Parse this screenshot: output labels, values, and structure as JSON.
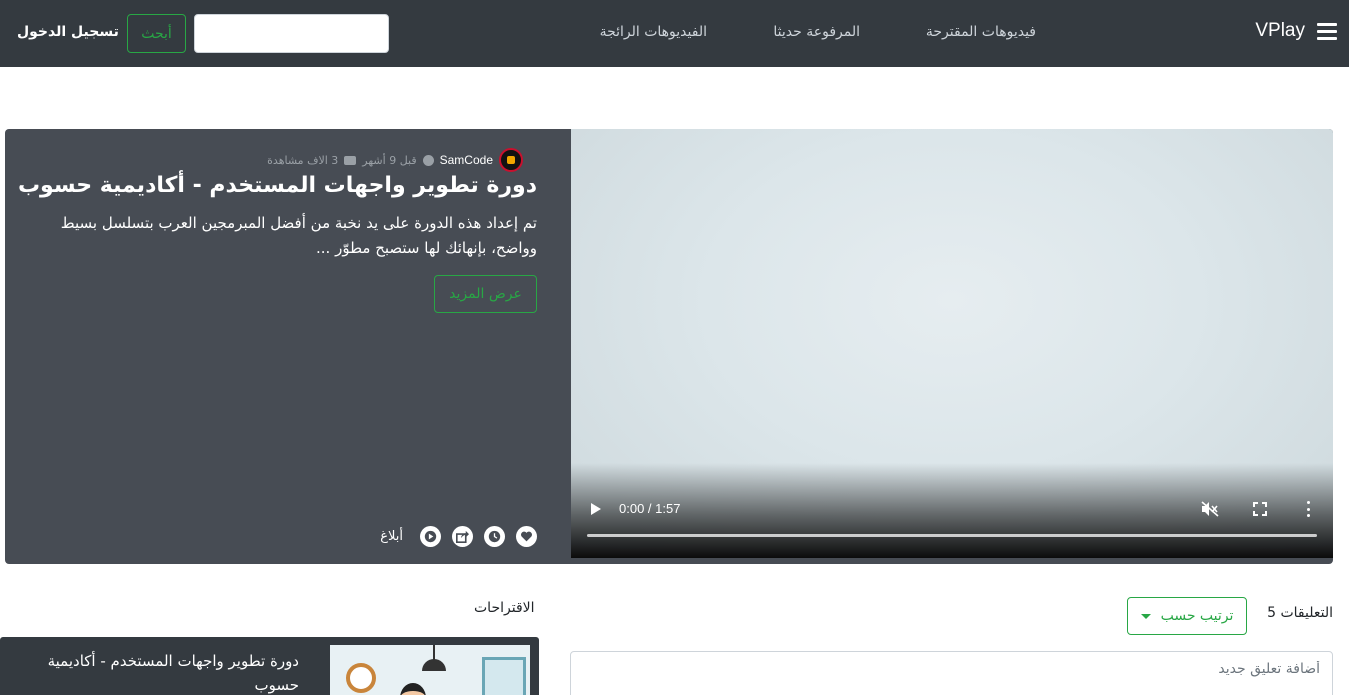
{
  "navbar": {
    "brand": "VPlay",
    "links": [
      "فيديوهات المقترحة",
      "المرفوعة حديثا",
      "الفيديوهات الرائجة"
    ],
    "search_button": "أبحث",
    "search_placeholder": "",
    "login": "تسجيل الدخول"
  },
  "video": {
    "title": "دورة تطوير واجهات المستخدم - أكاديمية حسوب",
    "description": "تم إعداد هذه الدورة على يد نخبة من أفضل المبرمجين العرب بتسلسل بسيط وواضح، بإنهائك لها ستصبح مطوّر ...",
    "views": "3 الاف مشاهدة",
    "uploaded": "قبل 9 أشهر",
    "channel": "SamCode",
    "show_more": "عرض المزيد",
    "report": "أبلاغ",
    "player": {
      "time": "0:00 / 1:57",
      "progress": 0
    },
    "action_icons": [
      "heart-icon",
      "clock-icon",
      "share-icon",
      "play-circle-icon"
    ]
  },
  "comments": {
    "label": "التعليقات 5",
    "sort_label": "ترتيب حسب",
    "input_placeholder": "أضافة تعليق جديد"
  },
  "suggestions": {
    "title": "الاقتراحات",
    "items": [
      {
        "title": "دورة تطوير واجهات المستخدم - أكاديمية حسوب"
      }
    ]
  },
  "colors": {
    "navbar_bg": "#343a40",
    "card_bg": "#474c54",
    "accent_green": "#28a745"
  }
}
